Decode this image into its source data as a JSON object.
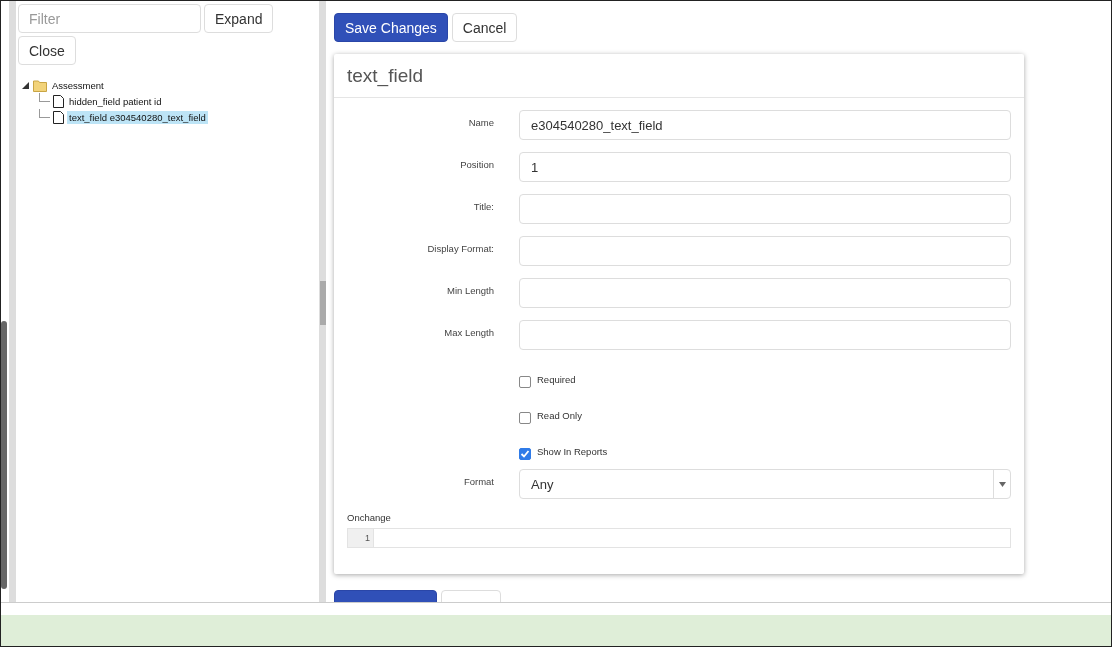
{
  "sidebar": {
    "filter": {
      "placeholder": "Filter"
    },
    "buttons": [
      "Expand",
      "Close"
    ],
    "tree": [
      {
        "label": "Assessment",
        "kind": "folder",
        "expanded": true,
        "selected": false,
        "children": [
          {
            "label": "hidden_field patient id",
            "kind": "file",
            "selected": false
          },
          {
            "label": "text_field e304540280_text_field",
            "kind": "file",
            "selected": true
          }
        ]
      }
    ]
  },
  "toolbar": {
    "save": "Save Changes",
    "cancel": "Cancel"
  },
  "editor": {
    "title": "text_field",
    "fields": [
      {
        "kind": "text",
        "label": "Name",
        "value": "e304540280_text_field"
      },
      {
        "kind": "text",
        "label": "Position",
        "value": "1"
      },
      {
        "kind": "text",
        "label": "Title:"
      },
      {
        "kind": "text",
        "label": "Display Format:"
      },
      {
        "kind": "text",
        "label": "Min Length"
      },
      {
        "kind": "text",
        "label": "Max Length"
      },
      {
        "kind": "checkbox",
        "label": "Required",
        "checked": false
      },
      {
        "kind": "checkbox",
        "label": "Read Only",
        "checked": false
      },
      {
        "kind": "checkbox",
        "label": "Show In Reports",
        "checked": true
      },
      {
        "kind": "select",
        "label": "Format",
        "value": "Any"
      }
    ],
    "code": {
      "label": "Onchange",
      "line_number": "1"
    }
  }
}
